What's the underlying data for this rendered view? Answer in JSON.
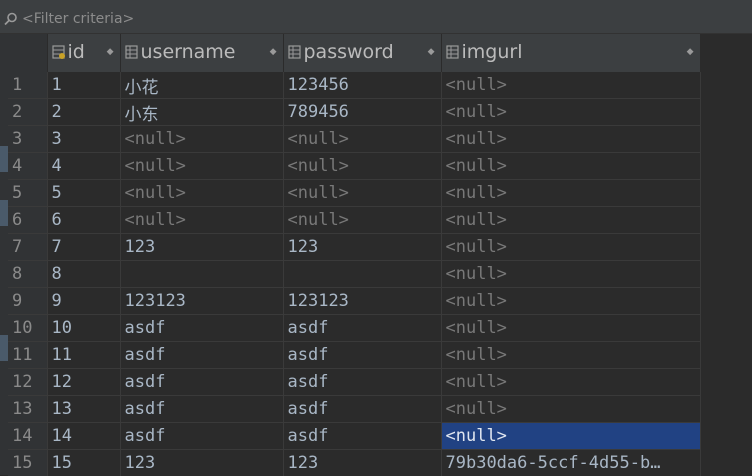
{
  "filter": {
    "icon": "search-icon",
    "placeholder": "<Filter criteria>"
  },
  "columns": [
    {
      "name": "id",
      "icon": "key-column-icon"
    },
    {
      "name": "username",
      "icon": "column-icon"
    },
    {
      "name": "password",
      "icon": "column-icon"
    },
    {
      "name": "imgurl",
      "icon": "column-icon"
    }
  ],
  "rows": [
    {
      "num": "1",
      "id": "1",
      "username": "小花",
      "password": "123456",
      "imgurl": "<null>"
    },
    {
      "num": "2",
      "id": "2",
      "username": "小东",
      "password": "789456",
      "imgurl": "<null>"
    },
    {
      "num": "3",
      "id": "3",
      "username": "<null>",
      "password": "<null>",
      "imgurl": "<null>"
    },
    {
      "num": "4",
      "id": "4",
      "username": "<null>",
      "password": "<null>",
      "imgurl": "<null>"
    },
    {
      "num": "5",
      "id": "5",
      "username": "<null>",
      "password": "<null>",
      "imgurl": "<null>"
    },
    {
      "num": "6",
      "id": "6",
      "username": "<null>",
      "password": "<null>",
      "imgurl": "<null>"
    },
    {
      "num": "7",
      "id": "7",
      "username": "123",
      "password": "123",
      "imgurl": "<null>"
    },
    {
      "num": "8",
      "id": "8",
      "username": "",
      "password": "",
      "imgurl": "<null>"
    },
    {
      "num": "9",
      "id": "9",
      "username": "123123",
      "password": "123123",
      "imgurl": "<null>"
    },
    {
      "num": "10",
      "id": "10",
      "username": "asdf",
      "password": "asdf",
      "imgurl": "<null>"
    },
    {
      "num": "11",
      "id": "11",
      "username": "asdf",
      "password": "asdf",
      "imgurl": "<null>"
    },
    {
      "num": "12",
      "id": "12",
      "username": "asdf",
      "password": "asdf",
      "imgurl": "<null>"
    },
    {
      "num": "13",
      "id": "13",
      "username": "asdf",
      "password": "asdf",
      "imgurl": "<null>"
    },
    {
      "num": "14",
      "id": "14",
      "username": "asdf",
      "password": "asdf",
      "imgurl": "<null>"
    },
    {
      "num": "15",
      "id": "15",
      "username": "123",
      "password": "123",
      "imgurl": "79b30da6-5ccf-4d55-b…"
    }
  ],
  "selected_cell": {
    "row": "14",
    "column": "imgurl"
  },
  "colors": {
    "background": "#2b2b2b",
    "selection": "#214283",
    "null_text": "#787878"
  }
}
